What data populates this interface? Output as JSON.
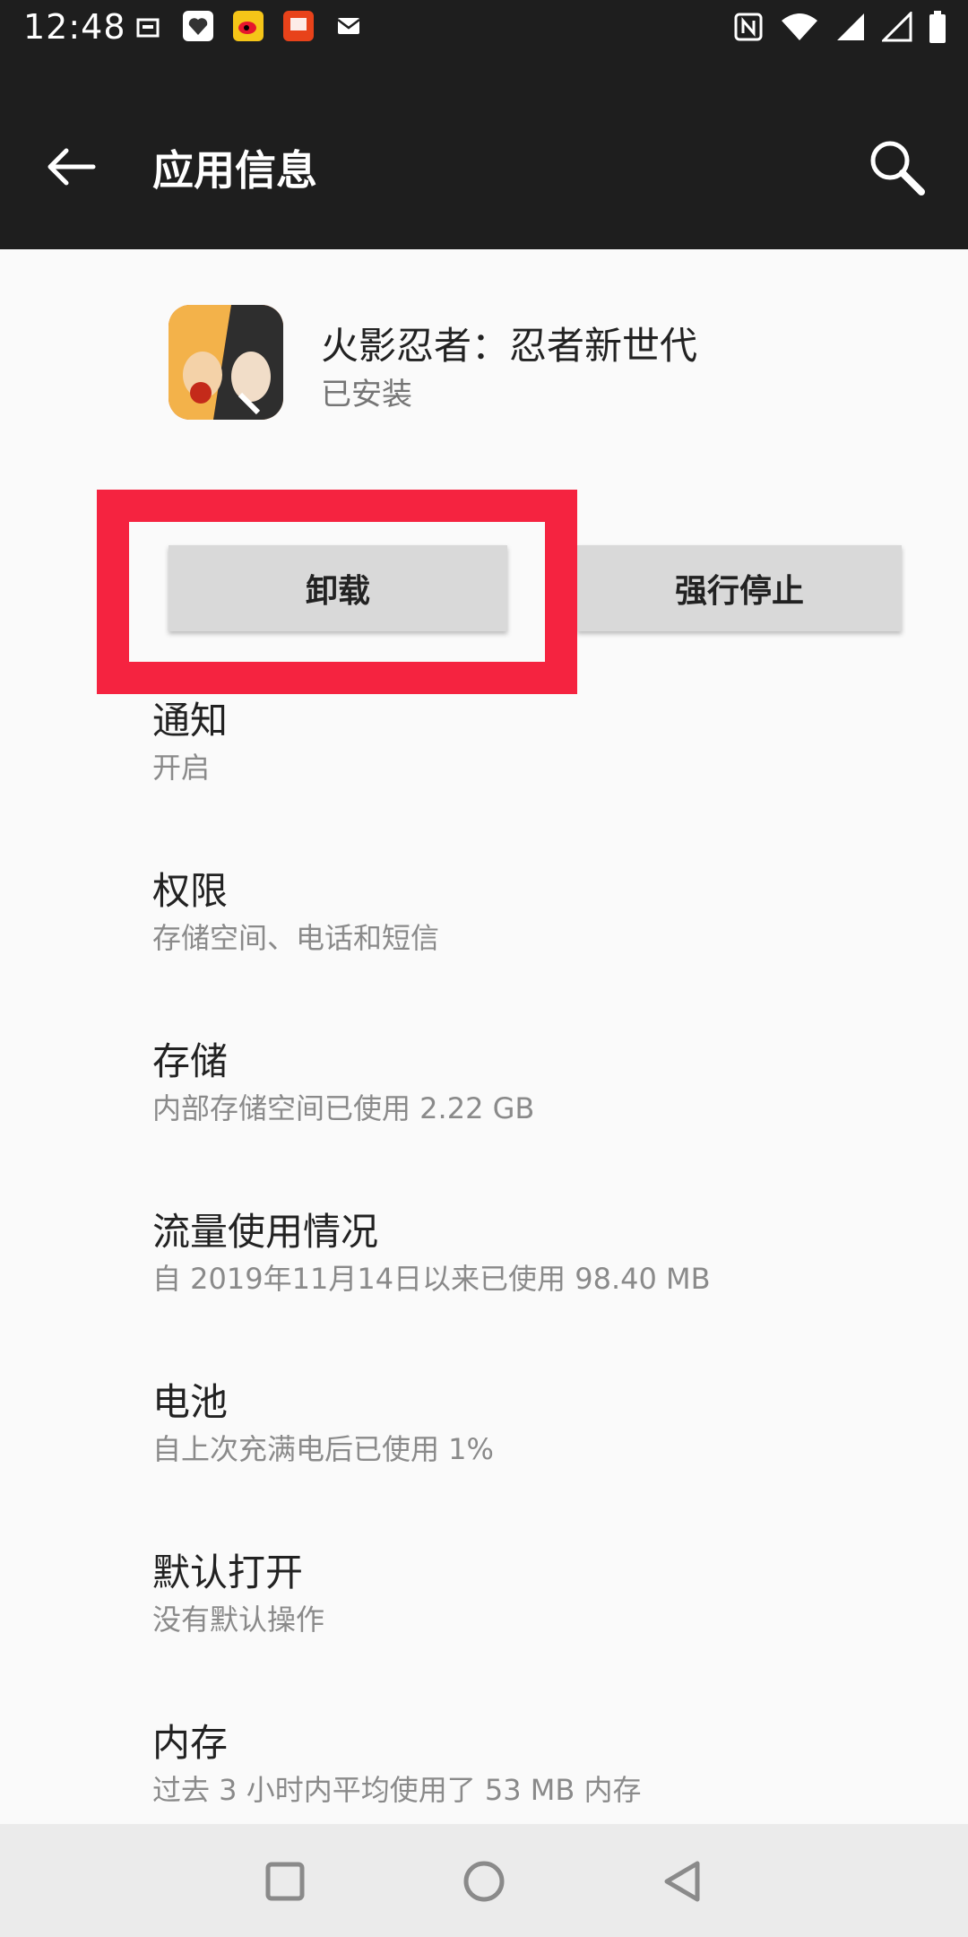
{
  "status_bar": {
    "time": "12:48"
  },
  "app_bar": {
    "title": "应用信息"
  },
  "app": {
    "name": "火影忍者：忍者新世代",
    "status": "已安装"
  },
  "buttons": {
    "uninstall": "卸载",
    "force_stop": "强行停止"
  },
  "items": [
    {
      "title": "通知",
      "subtitle": "开启"
    },
    {
      "title": "权限",
      "subtitle": "存储空间、电话和短信"
    },
    {
      "title": "存储",
      "subtitle": "内部存储空间已使用 2.22 GB"
    },
    {
      "title": "流量使用情况",
      "subtitle": "自 2019年11月14日以来已使用 98.40 MB"
    },
    {
      "title": "电池",
      "subtitle": "自上次充满电后已使用 1%"
    },
    {
      "title": "默认打开",
      "subtitle": "没有默认操作"
    },
    {
      "title": "内存",
      "subtitle": "过去 3 小时内平均使用了 53 MB 内存"
    }
  ],
  "colors": {
    "highlight": "#f52340",
    "appbar": "#1e1e1e",
    "button": "#d9d9d9"
  }
}
